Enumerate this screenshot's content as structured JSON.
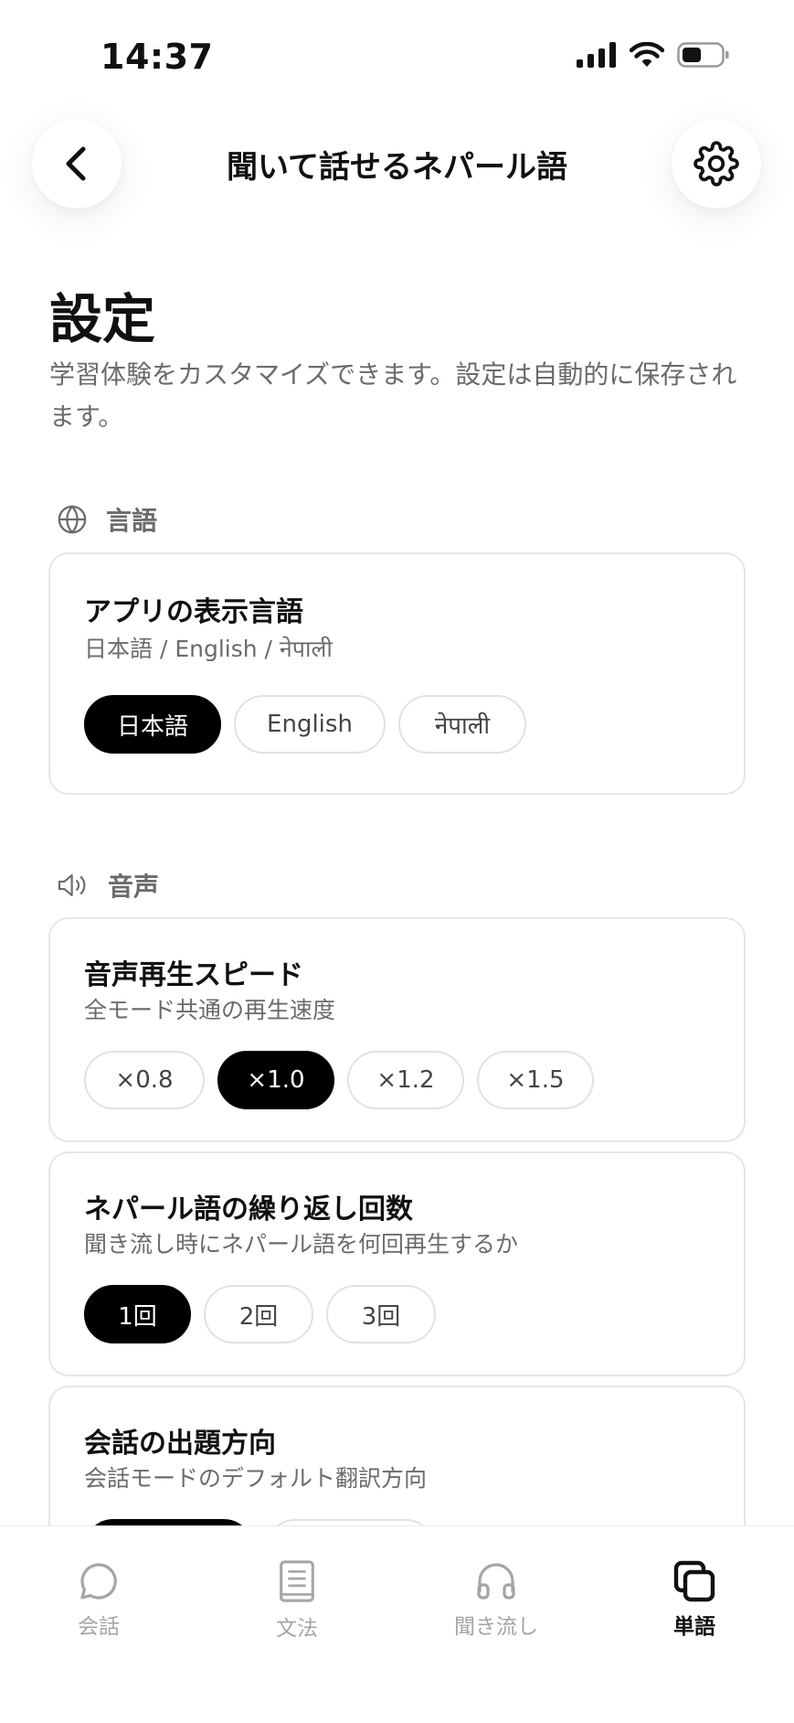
{
  "status_bar": {
    "time": "14:37"
  },
  "header": {
    "title": "聞いて話せるネパール語"
  },
  "page": {
    "title": "設定",
    "description": "学習体験をカスタマイズできます。設定は自動的に保存されます。"
  },
  "sections": {
    "language": {
      "heading": "言語",
      "card": {
        "title": "アプリの表示言語",
        "subtitle": "日本語 / English / नेपाली",
        "options": [
          "日本語",
          "English",
          "नेपाली"
        ],
        "selected": "日本語"
      }
    },
    "audio": {
      "heading": "音声",
      "speed": {
        "title": "音声再生スピード",
        "subtitle": "全モード共通の再生速度",
        "options": [
          "×0.8",
          "×1.0",
          "×1.2",
          "×1.5"
        ],
        "selected": "×1.0"
      },
      "repeat": {
        "title": "ネパール語の繰り返し回数",
        "subtitle": "聞き流し時にネパール語を何回再生するか",
        "options": [
          "1回",
          "2回",
          "3回"
        ],
        "selected": "1回"
      },
      "direction": {
        "title": "会話の出題方向",
        "subtitle": "会話モードのデフォルト翻訳方向"
      }
    }
  },
  "tab_bar": {
    "items": [
      {
        "label": "会話",
        "icon": "chat-bubble-icon"
      },
      {
        "label": "文法",
        "icon": "book-icon"
      },
      {
        "label": "聞き流し",
        "icon": "headphones-icon"
      },
      {
        "label": "単語",
        "icon": "stacked-cards-icon"
      }
    ],
    "active": "単語"
  },
  "colors": {
    "accent": "#000000",
    "muted_text": "#6b6b6b",
    "inactive_tab": "#a5a5a5",
    "card_border": "#e6e6e6"
  }
}
